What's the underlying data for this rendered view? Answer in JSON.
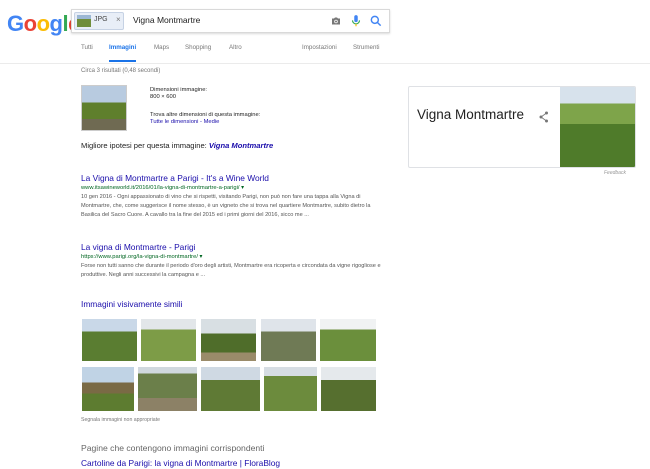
{
  "header": {
    "logo": "Google",
    "search": {
      "chip_label": "JPG",
      "chip_close": "×",
      "query": "Vigna Montmartre"
    },
    "tabs": [
      {
        "label": "Tutti"
      },
      {
        "label": "Immagini",
        "active": true
      },
      {
        "label": "Maps"
      },
      {
        "label": "Shopping"
      },
      {
        "label": "Altro"
      }
    ],
    "settings": "Impostazioni",
    "tools": "Strumenti"
  },
  "main": {
    "stats": "Circa 3 risultati (0,48 secondi)",
    "image_info": {
      "dimensions_label": "Dimensioni immagine:",
      "dimensions_value": "800 × 600",
      "other_dims_label": "Trova altre dimensioni di questa immagine:",
      "other_dims_links": "Tutte le dimensioni - Medie"
    },
    "best_guess": {
      "label": "Migliore ipotesi per questa immagine:",
      "value": "Vigna Montmartre"
    },
    "results": [
      {
        "title": "La Vigna di Montmartre a Parigi - It's a Wine World",
        "url": "www.itsawineworld.it/2016/01/la-vigna-di-montmartre-a-parigi/ ▾",
        "snippet": "10 gen 2016 - Ogni appassionato di vino che si rispetti, visitando Parigi, non può non fare una tappa alla Vigna di Montmartre, che, come suggerisce il nome stesso, è un vigneto che si trova nel quartiere Montmartre, subito dietro la Basilica del Sacro Cuore. A cavallo tra la fine del 2015 ed i primi giorni del 2016, sicco me ..."
      },
      {
        "title": "La vigna di Montmartre - Parigi",
        "url": "https://www.parigi.org/la-vigna-di-montmartre/ ▾",
        "snippet": "Forse non tutti sanno che durante il periodo d'oro degli artisti, Montmartre era ricoperta e circondata da vigne rigogliose e produttive. Negli anni successivi la campagna e ..."
      }
    ],
    "similar": {
      "title": "Immagini visivamente simili",
      "report": "Segnala immagini non appropriate"
    },
    "pages": {
      "title": "Pagine che contengono immagini corrispondenti",
      "link": "Cartoline da Parigi: la vigna di Montmartre | FloraBlog"
    }
  },
  "knowledge_panel": {
    "title": "Vigna Montmartre",
    "feedback": "Feedback"
  },
  "colors": {
    "link": "#1a0dab",
    "url_green": "#006621",
    "active_tab": "#1a73e8"
  }
}
